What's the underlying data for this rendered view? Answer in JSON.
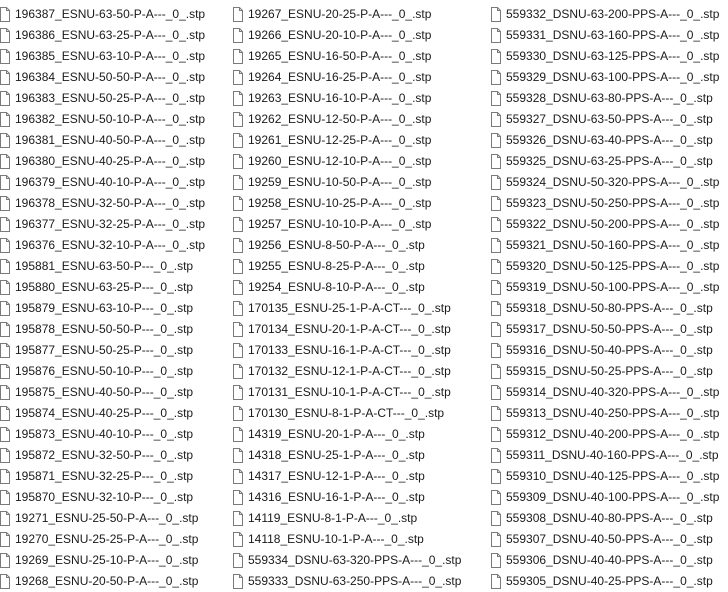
{
  "file_list": {
    "icon": "document-icon",
    "columns": [
      {
        "files": [
          "196387_ESNU-63-50-P-A---_0_.stp",
          "196386_ESNU-63-25-P-A---_0_.stp",
          "196385_ESNU-63-10-P-A---_0_.stp",
          "196384_ESNU-50-50-P-A---_0_.stp",
          "196383_ESNU-50-25-P-A---_0_.stp",
          "196382_ESNU-50-10-P-A---_0_.stp",
          "196381_ESNU-40-50-P-A---_0_.stp",
          "196380_ESNU-40-25-P-A---_0_.stp",
          "196379_ESNU-40-10-P-A---_0_.stp",
          "196378_ESNU-32-50-P-A---_0_.stp",
          "196377_ESNU-32-25-P-A---_0_.stp",
          "196376_ESNU-32-10-P-A---_0_.stp",
          "195881_ESNU-63-50-P---_0_.stp",
          "195880_ESNU-63-25-P---_0_.stp",
          "195879_ESNU-63-10-P---_0_.stp",
          "195878_ESNU-50-50-P---_0_.stp",
          "195877_ESNU-50-25-P---_0_.stp",
          "195876_ESNU-50-10-P---_0_.stp",
          "195875_ESNU-40-50-P---_0_.stp",
          "195874_ESNU-40-25-P---_0_.stp",
          "195873_ESNU-40-10-P---_0_.stp",
          "195872_ESNU-32-50-P---_0_.stp",
          "195871_ESNU-32-25-P---_0_.stp",
          "195870_ESNU-32-10-P---_0_.stp",
          "19271_ESNU-25-50-P-A---_0_.stp",
          "19270_ESNU-25-25-P-A---_0_.stp",
          "19269_ESNU-25-10-P-A---_0_.stp",
          "19268_ESNU-20-50-P-A---_0_.stp"
        ]
      },
      {
        "files": [
          "19267_ESNU-20-25-P-A---_0_.stp",
          "19266_ESNU-20-10-P-A---_0_.stp",
          "19265_ESNU-16-50-P-A---_0_.stp",
          "19264_ESNU-16-25-P-A---_0_.stp",
          "19263_ESNU-16-10-P-A---_0_.stp",
          "19262_ESNU-12-50-P-A---_0_.stp",
          "19261_ESNU-12-25-P-A---_0_.stp",
          "19260_ESNU-12-10-P-A---_0_.stp",
          "19259_ESNU-10-50-P-A---_0_.stp",
          "19258_ESNU-10-25-P-A---_0_.stp",
          "19257_ESNU-10-10-P-A---_0_.stp",
          "19256_ESNU-8-50-P-A---_0_.stp",
          "19255_ESNU-8-25-P-A---_0_.stp",
          "19254_ESNU-8-10-P-A---_0_.stp",
          "170135_ESNU-25-1-P-A-CT---_0_.stp",
          "170134_ESNU-20-1-P-A-CT---_0_.stp",
          "170133_ESNU-16-1-P-A-CT---_0_.stp",
          "170132_ESNU-12-1-P-A-CT---_0_.stp",
          "170131_ESNU-10-1-P-A-CT---_0_.stp",
          "170130_ESNU-8-1-P-A-CT---_0_.stp",
          "14319_ESNU-20-1-P-A---_0_.stp",
          "14318_ESNU-25-1-P-A---_0_.stp",
          "14317_ESNU-12-1-P-A---_0_.stp",
          "14316_ESNU-16-1-P-A---_0_.stp",
          "14119_ESNU-8-1-P-A---_0_.stp",
          "14118_ESNU-10-1-P-A---_0_.stp",
          "559334_DSNU-63-320-PPS-A---_0_.stp",
          "559333_DSNU-63-250-PPS-A---_0_.stp"
        ]
      },
      {
        "files": [
          "559332_DSNU-63-200-PPS-A---_0_.stp",
          "559331_DSNU-63-160-PPS-A---_0_.stp",
          "559330_DSNU-63-125-PPS-A---_0_.stp",
          "559329_DSNU-63-100-PPS-A---_0_.stp",
          "559328_DSNU-63-80-PPS-A---_0_.stp",
          "559327_DSNU-63-50-PPS-A---_0_.stp",
          "559326_DSNU-63-40-PPS-A---_0_.stp",
          "559325_DSNU-63-25-PPS-A---_0_.stp",
          "559324_DSNU-50-320-PPS-A---_0_.stp",
          "559323_DSNU-50-250-PPS-A---_0_.stp",
          "559322_DSNU-50-200-PPS-A---_0_.stp",
          "559321_DSNU-50-160-PPS-A---_0_.stp",
          "559320_DSNU-50-125-PPS-A---_0_.stp",
          "559319_DSNU-50-100-PPS-A---_0_.stp",
          "559318_DSNU-50-80-PPS-A---_0_.stp",
          "559317_DSNU-50-50-PPS-A---_0_.stp",
          "559316_DSNU-50-40-PPS-A---_0_.stp",
          "559315_DSNU-50-25-PPS-A---_0_.stp",
          "559314_DSNU-40-320-PPS-A---_0_.stp",
          "559313_DSNU-40-250-PPS-A---_0_.stp",
          "559312_DSNU-40-200-PPS-A---_0_.stp",
          "559311_DSNU-40-160-PPS-A---_0_.stp",
          "559310_DSNU-40-125-PPS-A---_0_.stp",
          "559309_DSNU-40-100-PPS-A---_0_.stp",
          "559308_DSNU-40-80-PPS-A---_0_.stp",
          "559307_DSNU-40-50-PPS-A---_0_.stp",
          "559306_DSNU-40-40-PPS-A---_0_.stp",
          "559305_DSNU-40-25-PPS-A---_0_.stp"
        ]
      }
    ]
  }
}
